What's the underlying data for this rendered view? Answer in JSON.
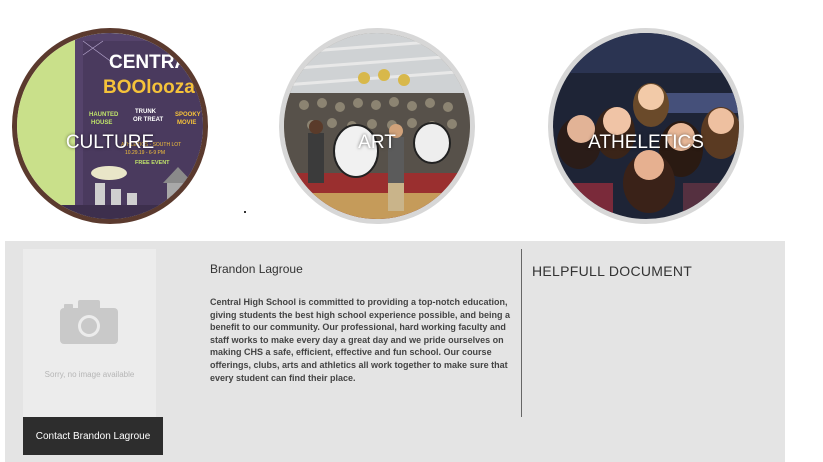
{
  "categories": [
    {
      "label": "CULTURE"
    },
    {
      "label": "ART"
    },
    {
      "label": "ATHELETICS"
    }
  ],
  "poster": {
    "line1": "CENTRAL",
    "line2": "BOOlooza",
    "item1a": "HAUNTED",
    "item1b": "HOUSE",
    "item2a": "TRUNK",
    "item2b": "OR TREAT",
    "item3a": "SPOOKY",
    "item3b": "MOVIE",
    "location": "ATHLETICS - SOUTH LOT",
    "datetime": "10.29.19 - 6-9 PM",
    "free": "FREE EVENT"
  },
  "profile": {
    "no_image_text": "Sorry, no image available",
    "contact_button": "Contact Brandon Lagroue",
    "name": "Brandon Lagroue",
    "bio": "Central High School is committed to providing a top-notch education, giving students the best high school experience possible, and being a benefit to our community. Our professional, hard working faculty and staff works to make every day a great day and we pride ourselves on making CHS a safe, efficient, effective and fun school. Our course offerings, clubs, arts and athletics all work together to make sure that every student can find their place."
  },
  "documents": {
    "heading": "HELPFULL DOCUMENT"
  },
  "colors": {
    "culture_border": "#5b3a2e",
    "circle_border": "#d7d7d7",
    "panel_bg": "#e4e4e4",
    "button_bg": "#2d2d2d"
  }
}
